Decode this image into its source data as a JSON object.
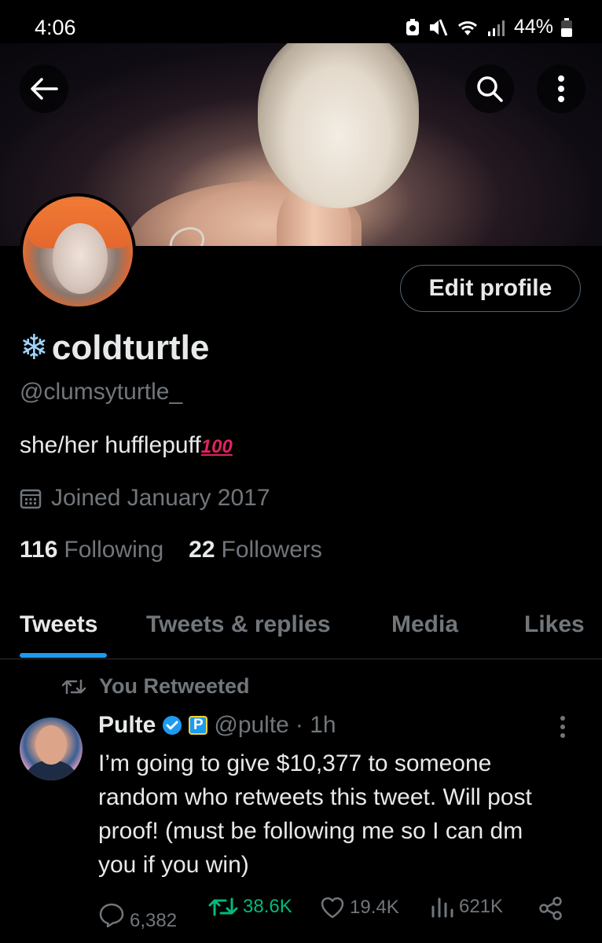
{
  "status_bar": {
    "time": "4:06",
    "battery": "44%"
  },
  "header": {
    "back_icon": "arrow-left-icon",
    "search_icon": "search-icon",
    "more_icon": "more-vertical-icon"
  },
  "profile": {
    "edit_label": "Edit profile",
    "display_name": "coldturtle",
    "name_emoji": "❄",
    "handle": "@clumsyturtle_",
    "bio": "she/her  hufflepuff",
    "bio_emoji": "100",
    "joined": "Joined January 2017",
    "following_count": "116",
    "following_label": "Following",
    "followers_count": "22",
    "followers_label": "Followers"
  },
  "tabs": [
    {
      "label": "Tweets",
      "active": true
    },
    {
      "label": "Tweets & replies",
      "active": false
    },
    {
      "label": "Media",
      "active": false
    },
    {
      "label": "Likes",
      "active": false
    }
  ],
  "tweet": {
    "retweet_context": "You Retweeted",
    "author_name": "Pulte",
    "badge_letter": "P",
    "author_handle": "@pulte",
    "time": "· 1h",
    "text": "I’m going to give $10,377 to someone random who retweets this tweet. Will post proof! (must be following me so I can dm you if you win)",
    "replies": "6,382",
    "retweets": "38.6K",
    "likes": "19.4K",
    "views": "621K"
  },
  "colors": {
    "accent": "#1d9bf0",
    "retweet_green": "#00ba7c",
    "muted": "#71767b"
  }
}
